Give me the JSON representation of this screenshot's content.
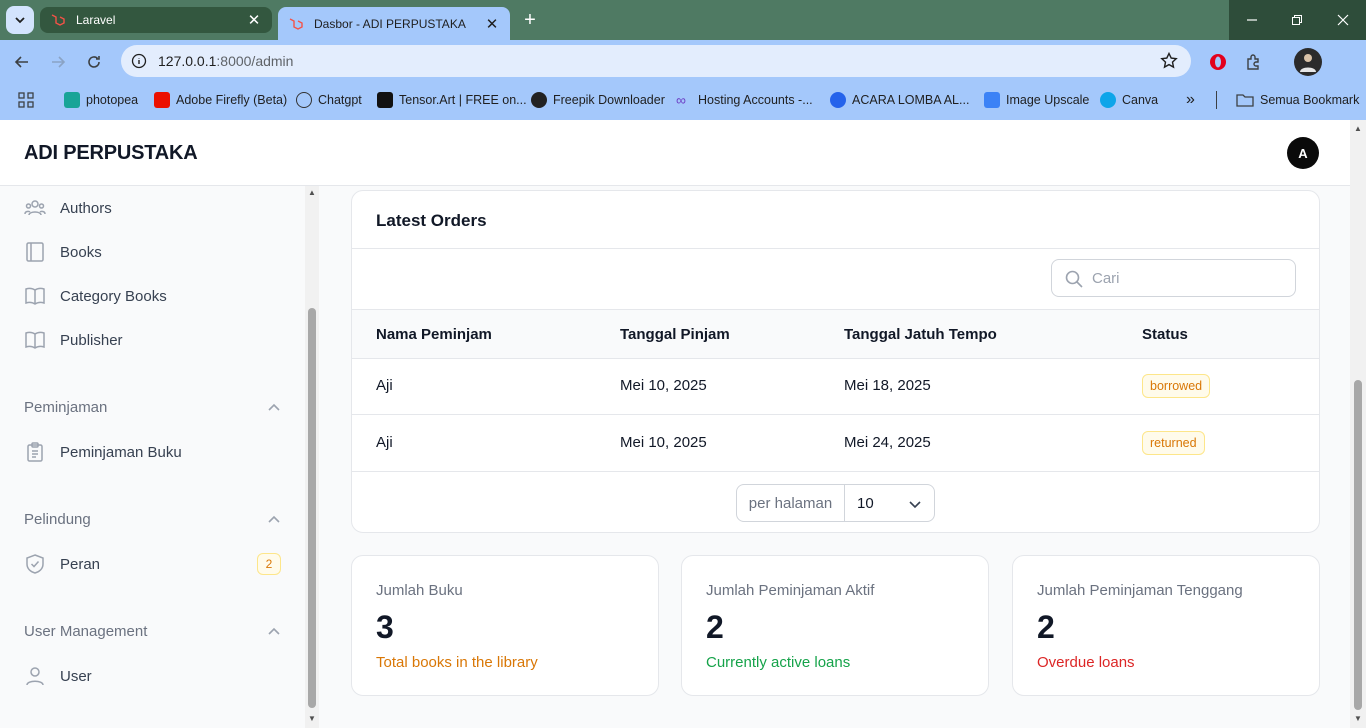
{
  "browser": {
    "tabs": [
      {
        "title": "Laravel",
        "active": false
      },
      {
        "title": "Dasbor - ADI PERPUSTAKA",
        "active": true
      }
    ],
    "url_host": "127.0.0.1",
    "url_rest": ":8000/admin",
    "bookmarks": [
      {
        "label": "photopea",
        "color": "#18a497"
      },
      {
        "label": "Adobe Firefly (Beta)",
        "color": "#eb1000"
      },
      {
        "label": "Chatgpt",
        "color": "#000000"
      },
      {
        "label": "Tensor.Art | FREE on...",
        "color": "#111111"
      },
      {
        "label": "Freepik Downloader",
        "color": "#222222"
      },
      {
        "label": "Hosting Accounts -...",
        "color": "#6c3fc5"
      },
      {
        "label": "ACARA LOMBA AL...",
        "color": "#2563eb"
      },
      {
        "label": "Image Upscale",
        "color": "#3b82f6"
      },
      {
        "label": "Canva",
        "color": "#0ea5e9"
      }
    ],
    "all_bookmarks_label": "Semua Bookmark"
  },
  "app": {
    "brand": "ADI PERPUSTAKA",
    "avatar_initial": "A"
  },
  "sidebar": {
    "items_top": [
      {
        "label": "Authors",
        "icon": "users-icon"
      },
      {
        "label": "Books",
        "icon": "book-icon"
      },
      {
        "label": "Category Books",
        "icon": "open-book-icon"
      },
      {
        "label": "Publisher",
        "icon": "open-book-icon"
      }
    ],
    "groups": [
      {
        "label": "Peminjaman",
        "items": [
          {
            "label": "Peminjaman Buku",
            "icon": "clipboard-icon"
          }
        ]
      },
      {
        "label": "Pelindung",
        "items": [
          {
            "label": "Peran",
            "icon": "shield-check-icon",
            "badge": "2"
          }
        ]
      },
      {
        "label": "User Management",
        "items": [
          {
            "label": "User",
            "icon": "user-icon"
          }
        ]
      }
    ]
  },
  "orders": {
    "title": "Latest Orders",
    "search_placeholder": "Cari",
    "columns": [
      "Nama Peminjam",
      "Tanggal Pinjam",
      "Tanggal Jatuh Tempo",
      "Status"
    ],
    "rows": [
      {
        "name": "Aji",
        "borrowed": "Mei 10, 2025",
        "due": "Mei 18, 2025",
        "status": "borrowed"
      },
      {
        "name": "Aji",
        "borrowed": "Mei 10, 2025",
        "due": "Mei 24, 2025",
        "status": "returned"
      }
    ],
    "per_page_label": "per halaman",
    "per_page_value": "10"
  },
  "stats": [
    {
      "label": "Jumlah Buku",
      "value": "3",
      "desc": "Total books in the library",
      "color": "#d97706"
    },
    {
      "label": "Jumlah Peminjaman Aktif",
      "value": "2",
      "desc": "Currently active loans",
      "color": "#16a34a"
    },
    {
      "label": "Jumlah Peminjaman Tenggang",
      "value": "2",
      "desc": "Overdue loans",
      "color": "#dc2626"
    }
  ]
}
